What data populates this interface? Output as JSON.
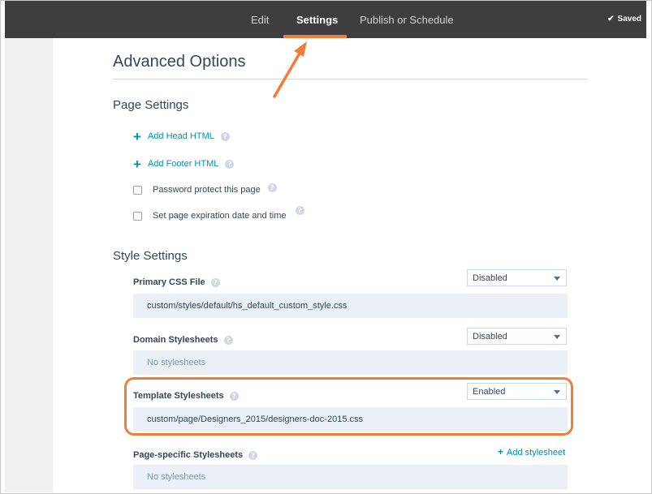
{
  "nav": {
    "tabs": [
      "Edit",
      "Settings",
      "Publish or Schedule"
    ],
    "saved": "Saved"
  },
  "page": {
    "title": "Advanced Options",
    "page_settings": {
      "heading": "Page Settings",
      "add_head_html": "Add Head HTML",
      "add_footer_html": "Add Footer HTML",
      "password_protect": "Password protect this page",
      "expiration": "Set page expiration date and time"
    },
    "style_settings": {
      "heading": "Style Settings",
      "primary_css": {
        "label": "Primary CSS File",
        "status": "Disabled",
        "value": "custom/styles/default/hs_default_custom_style.css"
      },
      "domain": {
        "label": "Domain Stylesheets",
        "status": "Disabled",
        "value": "No stylesheets"
      },
      "template": {
        "label": "Template Stylesheets",
        "status": "Enabled",
        "value": "custom/page/Designers_2015/designers-doc-2015.css"
      },
      "page_specific": {
        "label": "Page-specific Stylesheets",
        "add_label": "Add stylesheet",
        "value": "No stylesheets"
      }
    }
  },
  "help_glyph": "?",
  "colors": {
    "accent": "#f27c38",
    "link": "#0091ae",
    "topbar": "#3e3e3e"
  }
}
